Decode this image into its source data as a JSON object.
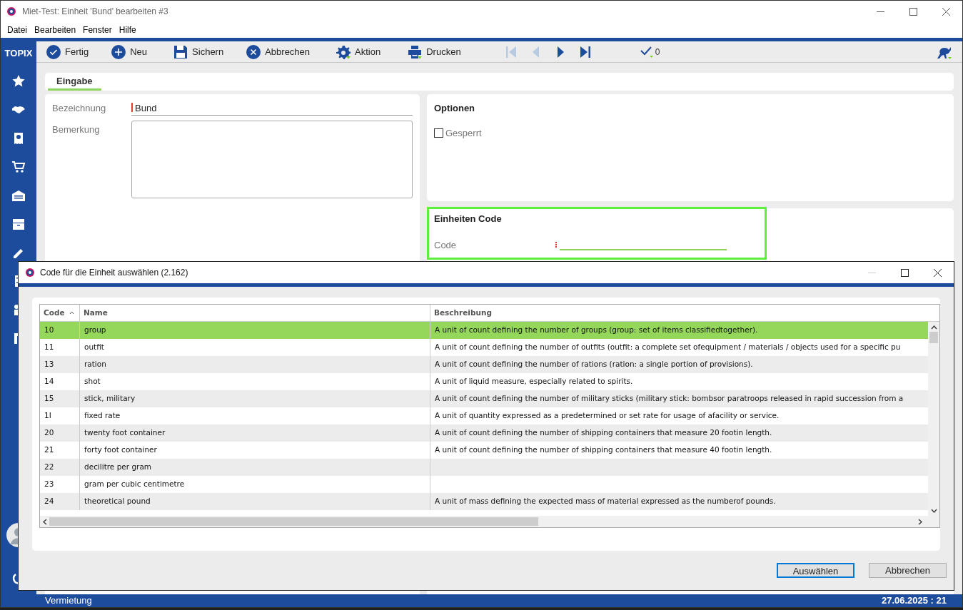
{
  "window": {
    "title": "Miet-Test: Einheit 'Bund' bearbeiten #3"
  },
  "menu": [
    "Datei",
    "Bearbeiten",
    "Fenster",
    "Hilfe"
  ],
  "brand": "TOPIX",
  "toolbar": [
    {
      "label": "Fertig"
    },
    {
      "label": "Neu"
    },
    {
      "label": "Sichern"
    },
    {
      "label": "Abbrechen"
    },
    {
      "label": "Aktion"
    },
    {
      "label": "Drucken"
    }
  ],
  "navigation": [
    {
      "disabled": true
    },
    {
      "disabled": true
    },
    {
      "disabled": false
    },
    {
      "disabled": false
    }
  ],
  "check_count": "0",
  "tabs": [
    {
      "label": "Eingabe",
      "selected": true
    }
  ],
  "form": {
    "fields": [
      {
        "label": "Bezeichnung",
        "value": "Bund"
      },
      {
        "label": "Bemerkung"
      }
    ]
  },
  "options": {
    "title": "Optionen",
    "checkbox": {
      "label": "Gesperrt",
      "checked": false
    }
  },
  "units_code": {
    "title": "Einheiten Code",
    "field": {
      "label": "Code"
    }
  },
  "dialog": {
    "title": "Code für die Einheit auswählen (2.162)",
    "columns": [
      {
        "label": "Code",
        "sorted_ascending": true
      },
      {
        "label": "Name"
      },
      {
        "label": "Beschreibung"
      }
    ],
    "rows": [
      {
        "code": "10",
        "name": "group",
        "description": "A unit of count defining the number of groups (group: set of items classifiedtogether).",
        "selected": true
      },
      {
        "code": "11",
        "name": "outfit",
        "description": "A unit of count defining the number of outfits (outfit: a complete set ofequipment / materials / objects used for a specific pu",
        "selected": false
      },
      {
        "code": "13",
        "name": "ration",
        "description": "A unit of count defining the number of rations (ration: a single portion of provisions).",
        "selected": false
      },
      {
        "code": "14",
        "name": "shot",
        "description": "A unit of liquid measure, especially related to spirits.",
        "selected": false
      },
      {
        "code": "15",
        "name": "stick, military",
        "description": "A unit of count defining the number of military sticks (military stick: bombsor paratroops released in rapid succession from a",
        "selected": false
      },
      {
        "code": "1I",
        "name": "fixed rate",
        "description": "A unit of quantity expressed as a predetermined or set rate for usage of afacility or service.",
        "selected": false
      },
      {
        "code": "20",
        "name": "twenty foot container",
        "description": "A unit of count defining the number of shipping containers that measure 20 footin length.",
        "selected": false
      },
      {
        "code": "21",
        "name": "forty foot container",
        "description": "A unit of count defining the number of shipping containers that measure 40 footin length.",
        "selected": false
      },
      {
        "code": "22",
        "name": "decilitre per gram",
        "selected": false
      },
      {
        "code": "23",
        "name": "gram per cubic centimetre",
        "selected": false
      },
      {
        "code": "24",
        "name": "theoretical pound",
        "description": "A unit of mass defining the expected mass of material expressed as the numberof pounds.",
        "selected": false
      }
    ],
    "buttons": [
      {
        "label": "Auswählen",
        "default": true
      },
      {
        "label": "Abbrechen",
        "default": false
      }
    ]
  },
  "status_bar": {
    "left": "Vermietung",
    "right": "27.06.2025 : 21"
  }
}
